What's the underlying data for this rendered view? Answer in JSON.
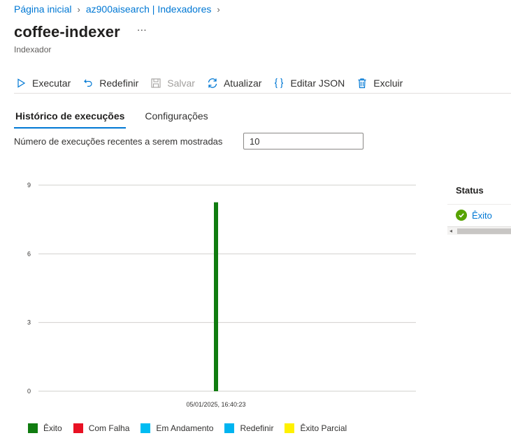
{
  "breadcrumb": {
    "items": [
      "Página inicial",
      "az900aisearch | Indexadores"
    ]
  },
  "page": {
    "title": "coffee-indexer",
    "more_label": "···",
    "subtitle": "Indexador"
  },
  "toolbar": {
    "run": "Executar",
    "reset": "Redefinir",
    "save": "Salvar",
    "refresh": "Atualizar",
    "edit_json": "Editar JSON",
    "delete": "Excluir"
  },
  "tabs": [
    "Histórico de execuções",
    "Configurações"
  ],
  "runs_filter": {
    "label": "Número de execuções recentes a serem mostradas",
    "value": "10"
  },
  "chart_data": {
    "type": "bar",
    "categories": [
      "05/01/2025, 16:40:23"
    ],
    "series": [
      {
        "name": "Êxito",
        "values": [
          8.25
        ],
        "color": "#107c10"
      }
    ],
    "ylim": [
      0,
      9
    ],
    "yticks": [
      "0",
      "3",
      "6",
      "9"
    ],
    "grid": true,
    "legend_position": "bottom",
    "legend": [
      {
        "label": "Êxito",
        "color": "#107c10"
      },
      {
        "label": "Com Falha",
        "color": "#e81123"
      },
      {
        "label": "Em Andamento",
        "color": "#00bcf2"
      },
      {
        "label": "Redefinir",
        "color": "#00b4f0"
      },
      {
        "label": "Êxito Parcial",
        "color": "#fff100"
      }
    ]
  },
  "side_panel": {
    "header": "Status",
    "rows": [
      {
        "status": "Êxito",
        "icon": "success-check-icon",
        "color": "#57a300"
      }
    ]
  }
}
